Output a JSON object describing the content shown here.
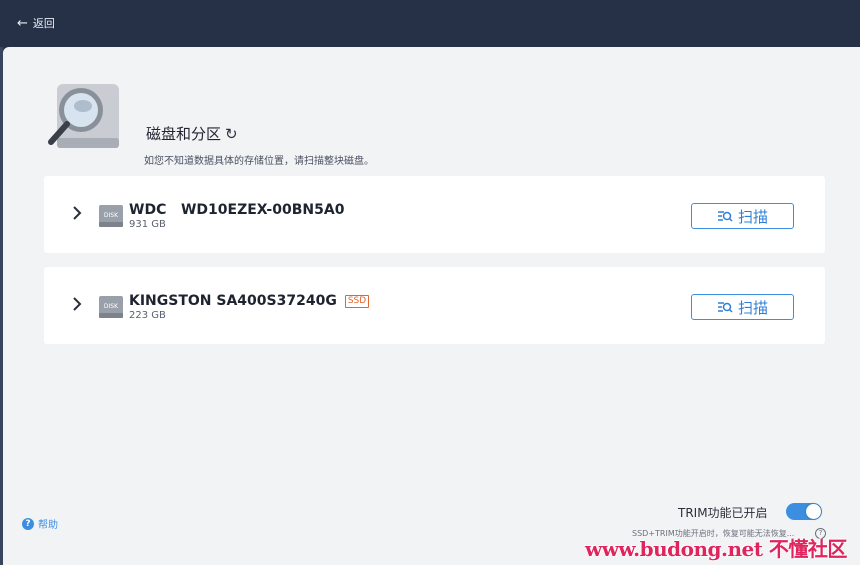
{
  "header": {
    "back_label": "返回"
  },
  "hero": {
    "title": "磁盘和分区",
    "subtitle": "如您不知道数据具体的存储位置，请扫描整块磁盘。"
  },
  "disks": [
    {
      "name": "WDC   WD10EZEX-00BN5A0",
      "size": "931 GB",
      "badge": "",
      "icon_label": "DISK",
      "scan_label": "扫描"
    },
    {
      "name": "KINGSTON SA400S37240G",
      "size": "223 GB",
      "badge": "SSD",
      "icon_label": "DISK",
      "scan_label": "扫描"
    }
  ],
  "footer": {
    "help_label": "帮助",
    "trim_label": "TRIM功能已开启",
    "trim_enabled": true,
    "trim_note": "SSD+TRIM功能开启时，恢复可能无法恢复...",
    "watermark": "www.budong.net 不懂社区"
  },
  "colors": {
    "accent": "#3c8fe0",
    "header_bg": "#263148",
    "badge": "#e2662d"
  }
}
